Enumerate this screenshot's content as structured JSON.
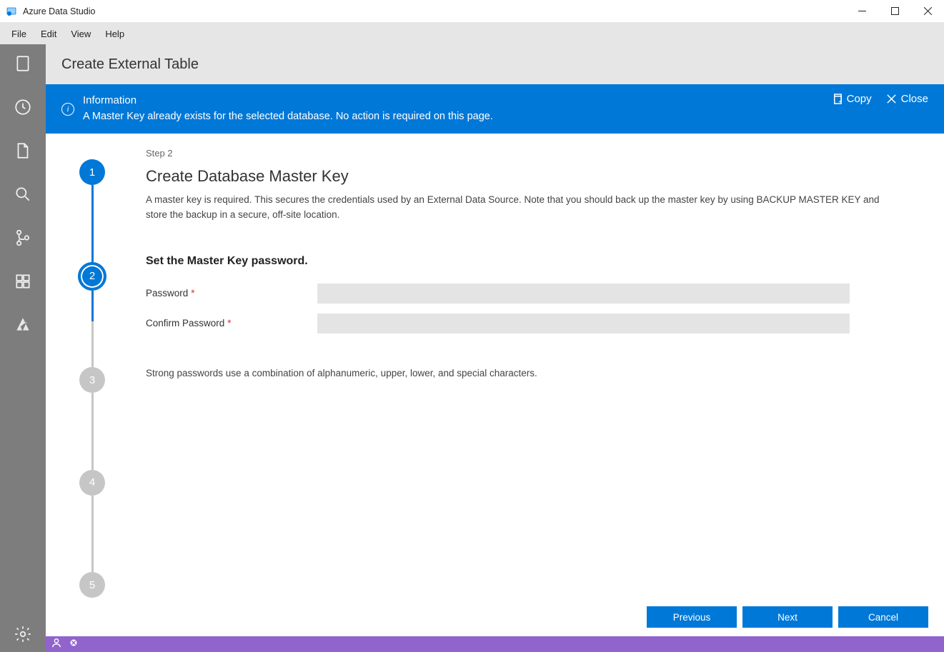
{
  "window": {
    "title": "Azure Data Studio"
  },
  "menu": {
    "items": [
      "File",
      "Edit",
      "View",
      "Help"
    ]
  },
  "activitybar": {
    "icons": [
      "servers-icon",
      "history-icon",
      "file-icon",
      "search-icon",
      "source-control-icon",
      "extensions-icon",
      "azure-icon"
    ],
    "settings": "settings-icon"
  },
  "header": {
    "title": "Create External Table"
  },
  "banner": {
    "title": "Information",
    "message": "A Master Key already exists for the selected database. No action is required on this page.",
    "copy_label": "Copy",
    "close_label": "Close"
  },
  "wizard": {
    "step_label": "Step 2",
    "step_title": "Create Database Master Key",
    "step_desc": "A master key is required. This secures the credentials used by an External Data Source. Note that you should back up the master key by using BACKUP MASTER KEY and store the backup in a secure, off-site location.",
    "section_title": "Set the Master Key password.",
    "password_label": "Password",
    "confirm_label": "Confirm Password",
    "hint": "Strong passwords use a combination of alphanumeric, upper, lower, and special characters.",
    "steps": [
      "1",
      "2",
      "3",
      "4",
      "5"
    ],
    "current_step": 2
  },
  "footer": {
    "previous": "Previous",
    "next": "Next",
    "cancel": "Cancel"
  }
}
